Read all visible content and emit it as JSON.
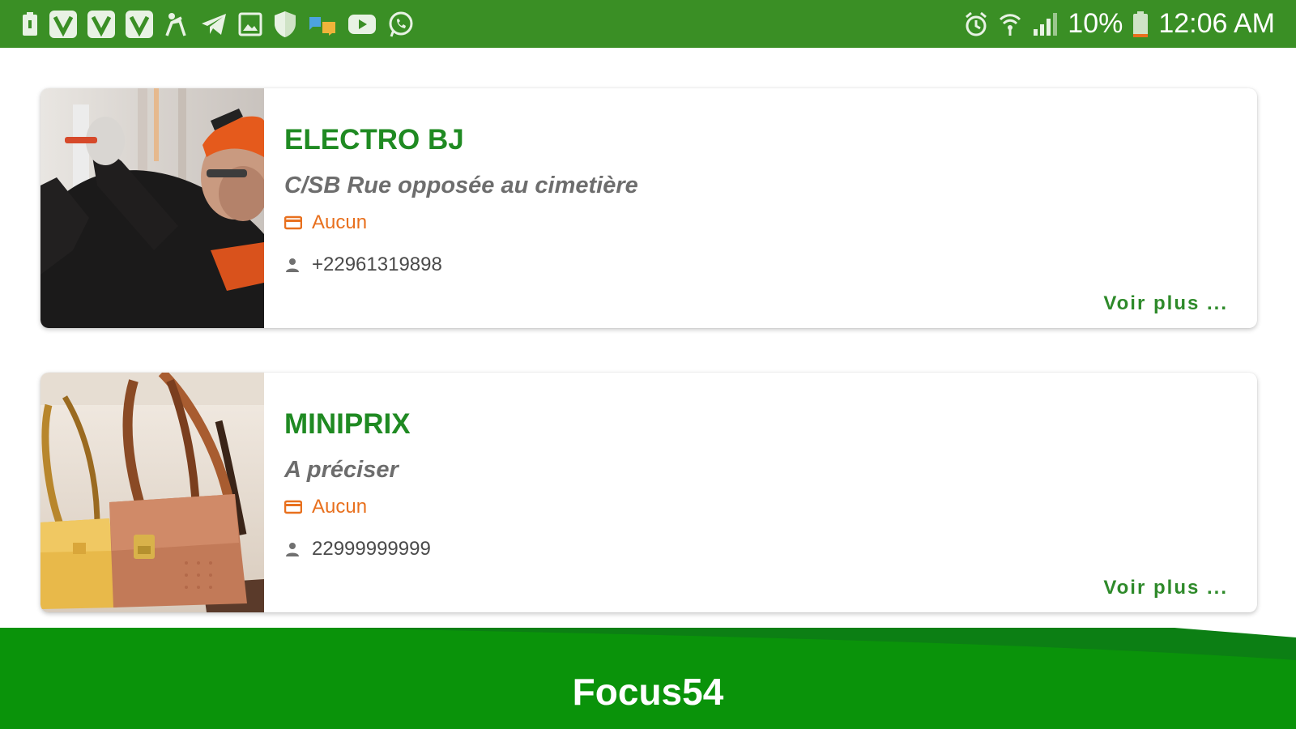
{
  "status_bar": {
    "battery_percent": "10%",
    "time": "12:06 AM",
    "left_icons": [
      "battery-saver-icon",
      "v-app-icon",
      "v-app-icon",
      "v-app-icon",
      "accessibility-icon",
      "telegram-icon",
      "gallery-icon",
      "shield-icon",
      "messages-icon",
      "youtube-icon",
      "whatsapp-icon"
    ],
    "right_icons": [
      "alarm-icon",
      "wifi-icon",
      "signal-icon",
      "battery-icon"
    ]
  },
  "listings": [
    {
      "title": "ELECTRO BJ",
      "address": "C/SB Rue opposée au cimetière",
      "category": "Aucun",
      "phone": "+22961319898",
      "more_label": "Voir plus ...",
      "image": "electrician-photo"
    },
    {
      "title": "MINIPRIX",
      "address": "A préciser",
      "category": "Aucun",
      "phone": "22999999999",
      "more_label": "Voir plus ...",
      "image": "handbags-photo"
    }
  ],
  "footer": {
    "app_name": "Focus54"
  },
  "colors": {
    "status_bar": "#3a8f25",
    "accent_green": "#1f8a22",
    "category_orange": "#e8701e",
    "footer_green": "#0a930a"
  }
}
